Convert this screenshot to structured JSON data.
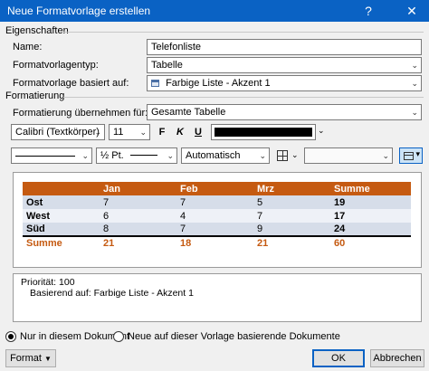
{
  "window": {
    "title": "Neue Formatvorlage erstellen",
    "help_label": "?",
    "close_label": "✕"
  },
  "properties": {
    "group_label": "Eigenschaften",
    "name_label": "Name:",
    "name_value": "Telefonliste",
    "type_label": "Formatvorlagentyp:",
    "type_value": "Tabelle",
    "based_on_label": "Formatvorlage basiert auf:",
    "based_on_value": "Farbige Liste - Akzent 1"
  },
  "formatting": {
    "group_label": "Formatierung",
    "apply_to_label": "Formatierung übernehmen für:",
    "apply_to_value": "Gesamte Tabelle",
    "font_value": "Calibri (Textkörper)",
    "size_value": "11",
    "bold_label": "F",
    "italic_label": "K",
    "underline_label": "U",
    "font_color": "#000000",
    "line_weight_value": "½ Pt.",
    "border_color_value": "Automatisch",
    "accent_color": "#c55a11"
  },
  "preview": {
    "header": [
      "",
      "Jan",
      "Feb",
      "Mrz",
      "Summe"
    ],
    "rows": [
      [
        "Ost",
        "7",
        "7",
        "5",
        "19"
      ],
      [
        "West",
        "6",
        "4",
        "7",
        "17"
      ],
      [
        "Süd",
        "8",
        "7",
        "9",
        "24"
      ]
    ],
    "total": [
      "Summe",
      "21",
      "18",
      "21",
      "60"
    ]
  },
  "description": {
    "priority": "Priorität: 100",
    "based_on": "Basierend auf: Farbige Liste - Akzent 1"
  },
  "footer": {
    "only_this_doc": "Nur in diesem Dokument",
    "new_docs": "Neue auf dieser Vorlage basierende Dokumente",
    "format_button": "Format",
    "ok_button": "OK",
    "cancel_button": "Abbrechen"
  }
}
